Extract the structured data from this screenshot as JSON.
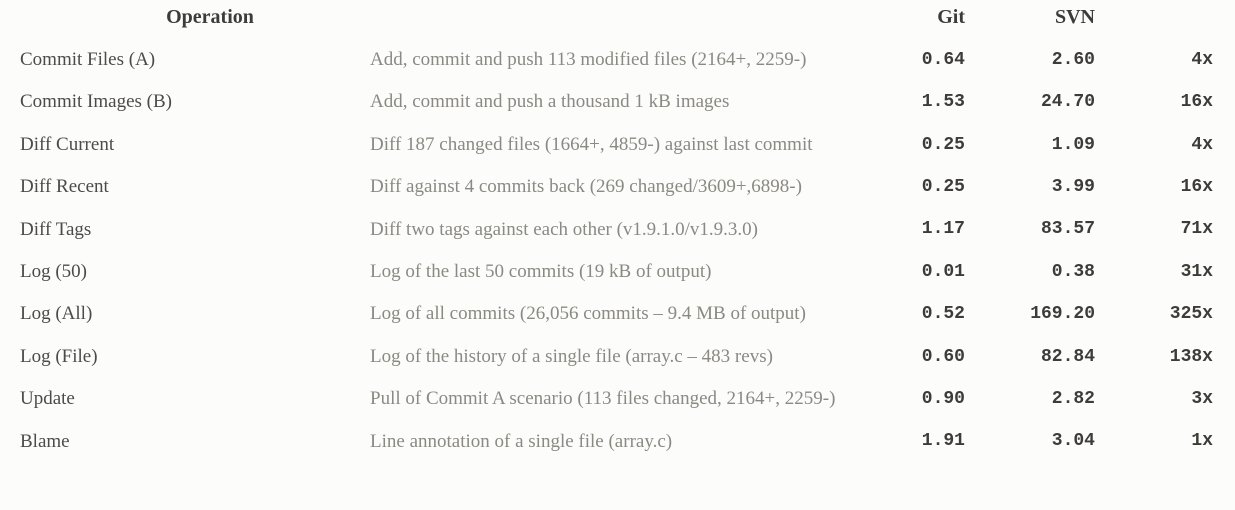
{
  "headers": {
    "operation": "Operation",
    "git": "Git",
    "svn": "SVN"
  },
  "rows": [
    {
      "op": "Commit Files (A)",
      "desc": "Add, commit and push 113 modified files (2164+, 2259-)",
      "git": "0.64",
      "svn": "2.60",
      "ratio": "4x"
    },
    {
      "op": "Commit Images (B)",
      "desc": "Add, commit and push a thousand 1 kB images",
      "git": "1.53",
      "svn": "24.70",
      "ratio": "16x"
    },
    {
      "op": "Diff Current",
      "desc": "Diff 187 changed files (1664+, 4859-) against last commit",
      "git": "0.25",
      "svn": "1.09",
      "ratio": "4x"
    },
    {
      "op": "Diff Recent",
      "desc": "Diff against 4 commits back (269 changed/3609+,6898-)",
      "git": "0.25",
      "svn": "3.99",
      "ratio": "16x"
    },
    {
      "op": "Diff Tags",
      "desc": "Diff two tags against each other (v1.9.1.0/v1.9.3.0)",
      "git": "1.17",
      "svn": "83.57",
      "ratio": "71x"
    },
    {
      "op": "Log (50)",
      "desc": "Log of the last 50 commits (19 kB of output)",
      "git": "0.01",
      "svn": "0.38",
      "ratio": "31x"
    },
    {
      "op": "Log (All)",
      "desc": "Log of all commits (26,056 commits – 9.4 MB of output)",
      "git": "0.52",
      "svn": "169.20",
      "ratio": "325x"
    },
    {
      "op": "Log (File)",
      "desc": "Log of the history of a single file (array.c – 483 revs)",
      "git": "0.60",
      "svn": "82.84",
      "ratio": "138x"
    },
    {
      "op": "Update",
      "desc": "Pull of Commit A scenario (113 files changed, 2164+, 2259-)",
      "git": "0.90",
      "svn": "2.82",
      "ratio": "3x"
    },
    {
      "op": "Blame",
      "desc": "Line annotation of a single file (array.c)",
      "git": "1.91",
      "svn": "3.04",
      "ratio": "1x"
    }
  ]
}
